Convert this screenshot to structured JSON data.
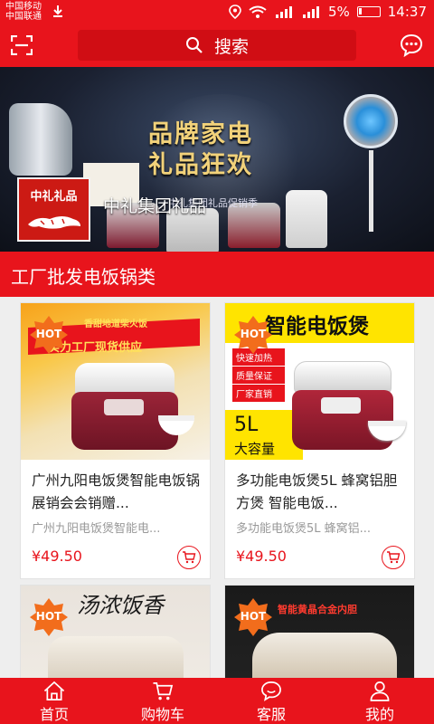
{
  "status_bar": {
    "carrier_1": "中国移动",
    "carrier_2": "中国联通",
    "battery": "5%",
    "time": "14:37"
  },
  "header": {
    "search_label": "搜索"
  },
  "banner": {
    "title_line_1": "品牌家电",
    "title_line_2": "礼品狂欢",
    "subtitle": "中礼集团礼品促销季",
    "logo_text": "中礼礼品",
    "brand_name": "中礼集团礼品"
  },
  "section": {
    "title": "工厂批发电饭锅类"
  },
  "products": [
    {
      "title": "广州九阳电饭煲智能电饭锅展销会会销赠...",
      "subtitle": "广州九阳电饭煲智能电...",
      "price": "¥49.50",
      "badge": "HOT",
      "image_text_1": "香甜地道柴火饭",
      "image_text_2": "实力工厂现货供应"
    },
    {
      "title": "多功能电饭煲5L 蜂窝铝胆方煲 智能电饭...",
      "subtitle": "多功能电饭煲5L 蜂窝铝...",
      "price": "¥49.50",
      "badge": "HOT",
      "image_text_1": "智能电饭煲",
      "image_tags": [
        "快速加热",
        "质量保证",
        "厂家直销"
      ],
      "image_text_2": "5L",
      "image_text_3": "大容量"
    },
    {
      "badge": "HOT",
      "image_text_1": "汤浓饭香"
    },
    {
      "badge": "HOT",
      "image_text_1": "智能黄晶合金内胆"
    }
  ],
  "bottom_nav": [
    {
      "label": "首页",
      "icon": "home-icon"
    },
    {
      "label": "购物车",
      "icon": "cart-icon"
    },
    {
      "label": "客服",
      "icon": "chat-icon"
    },
    {
      "label": "我的",
      "icon": "user-icon"
    }
  ],
  "colors": {
    "primary": "#e8141c",
    "price": "#e8141c",
    "hot_badge": "#f26d1c"
  }
}
